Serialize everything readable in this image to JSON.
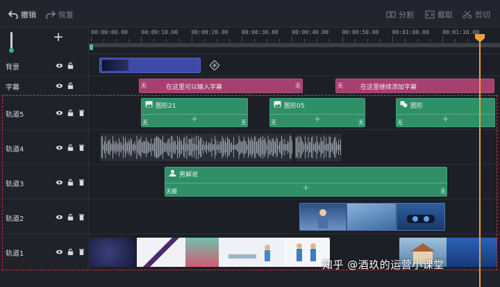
{
  "toolbar": {
    "undo_label": "撤销",
    "redo_label": "恢复",
    "split_label": "分割",
    "crop_label": "截取",
    "cut_label": "剪切"
  },
  "ruler": {
    "ticks": [
      "00:00:00.00",
      "00:00:10.00",
      "00:00:20.00",
      "00:00:30.00",
      "00:00:40.00",
      "00:00:50.00",
      "00:01:00.00",
      "00:01:10.00"
    ]
  },
  "rows": {
    "background": {
      "name": "背景"
    },
    "subtitle": {
      "name": "字幕",
      "clip1_text": "在这里可以输入字幕",
      "clip2_text": "在这里继续添加字幕",
      "none_label": "无"
    },
    "track5": {
      "name": "轨道5",
      "clip1_title": "图形21",
      "clip2_title": "图形05",
      "clip3_title": "图形",
      "edge_label": "无"
    },
    "track4": {
      "name": "轨道4"
    },
    "track3": {
      "name": "轨道3",
      "clip_title": "男解说",
      "edge_left": "无摄",
      "edge_right": "无"
    },
    "track2": {
      "name": "轨道2"
    },
    "track1": {
      "name": "轨道1"
    }
  },
  "watermark": "知乎 @酒玖的运营小课堂",
  "colors": {
    "accent_green": "#2f8f67",
    "subtitle_pink": "#a6406f",
    "playhead": "#f0a038",
    "selection_dash": "#e02b2b"
  }
}
